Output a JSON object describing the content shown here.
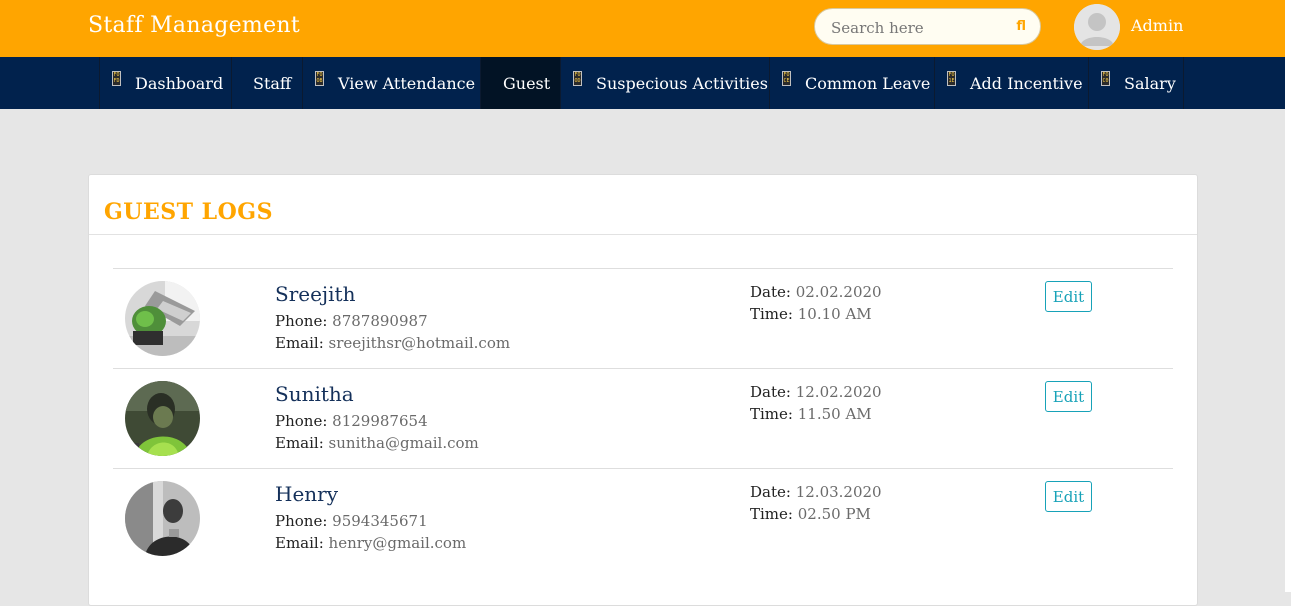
{
  "header": {
    "brand": "Staff Management",
    "search_placeholder": "Search here",
    "search_icon_glyph": "fl",
    "user_name": "Admin"
  },
  "nav": {
    "items": [
      {
        "label": "Dashboard",
        "icon": "app-icon",
        "icon_text": "FO FD",
        "active": false
      },
      {
        "label": "Staff",
        "icon": "none",
        "active": false
      },
      {
        "label": "View Attendance",
        "icon": "app-icon",
        "icon_text": "FO OB",
        "active": false
      },
      {
        "label": "Guest",
        "icon": "none",
        "active": true
      },
      {
        "label": "Suspecious Activities",
        "icon": "app-icon",
        "icon_text": "FO OD",
        "active": false
      },
      {
        "label": "Common Leave",
        "icon": "app-icon",
        "icon_text": "FO CE",
        "active": false
      },
      {
        "label": "Add Incentive",
        "icon": "app-icon",
        "icon_text": "FO 1E",
        "active": false
      },
      {
        "label": "Salary",
        "icon": "app-icon",
        "icon_text": "FO C0",
        "active": false
      }
    ]
  },
  "main": {
    "title": "GUEST LOGS",
    "labels": {
      "phone": "Phone:",
      "email": "Email:",
      "date": "Date:",
      "time": "Time:",
      "edit": "Edit"
    },
    "guests": [
      {
        "name": "Sreejith",
        "phone": "8787890987",
        "email": "sreejithsr@hotmail.com",
        "date": "02.02.2020",
        "time": "10.10 AM"
      },
      {
        "name": "Sunitha",
        "phone": "8129987654",
        "email": "sunitha@gmail.com",
        "date": "12.02.2020",
        "time": "11.50 AM"
      },
      {
        "name": "Henry",
        "phone": "9594345671",
        "email": "henry@gmail.com",
        "date": "12.03.2020",
        "time": "02.50 PM"
      }
    ]
  },
  "colors": {
    "topbar": "#ffa500",
    "navbar": "#01224d",
    "accent": "#ffa500",
    "edit_button": "#17a2b8"
  }
}
